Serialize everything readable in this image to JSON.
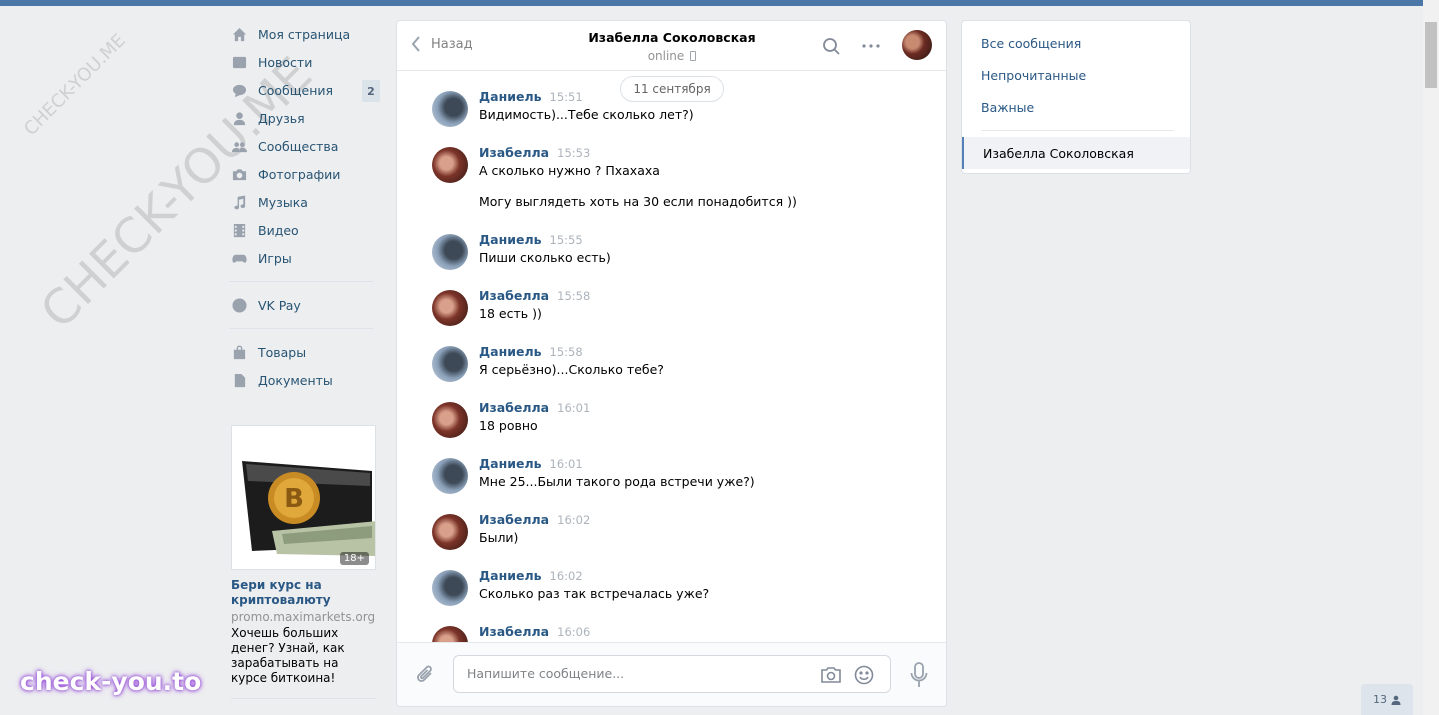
{
  "nav": {
    "items": [
      {
        "label": "Моя страница",
        "icon": "home-icon"
      },
      {
        "label": "Новости",
        "icon": "news-icon"
      },
      {
        "label": "Сообщения",
        "icon": "messages-icon",
        "badge": "2"
      },
      {
        "label": "Друзья",
        "icon": "friends-icon"
      },
      {
        "label": "Сообщества",
        "icon": "groups-icon"
      },
      {
        "label": "Фотографии",
        "icon": "camera-icon"
      },
      {
        "label": "Музыка",
        "icon": "music-icon"
      },
      {
        "label": "Видео",
        "icon": "video-icon"
      },
      {
        "label": "Игры",
        "icon": "games-icon"
      },
      {
        "label": "VK Pay",
        "icon": "vkpay-icon"
      },
      {
        "label": "Товары",
        "icon": "bag-icon"
      },
      {
        "label": "Документы",
        "icon": "document-icon"
      }
    ]
  },
  "ad": {
    "badge": "18+",
    "title": "Бери курс на криптовалюту",
    "domain": "promo.maximarkets.org",
    "text": "Хочешь больших денег? Узнай, как зарабатывать на курсе биткоина!"
  },
  "chat": {
    "back_label": "Назад",
    "peer_name": "Изабелла Соколовская",
    "peer_status": "online",
    "date_label": "11 сентября",
    "messages": [
      {
        "author": "Даниель",
        "time": "15:51",
        "lines": [
          "Видимость)...Тебе сколько лет?)"
        ]
      },
      {
        "author": "Изабелла",
        "time": "15:53",
        "lines": [
          "А сколько нужно ? Пхахаха",
          "Могу выглядеть хоть на 30 если понадобится ))"
        ]
      },
      {
        "author": "Даниель",
        "time": "15:55",
        "lines": [
          "Пиши сколько есть)"
        ]
      },
      {
        "author": "Изабелла",
        "time": "15:58",
        "lines": [
          "18 есть ))"
        ]
      },
      {
        "author": "Даниель",
        "time": "15:58",
        "lines": [
          "Я серьёзно)...Сколько тебе?"
        ]
      },
      {
        "author": "Изабелла",
        "time": "16:01",
        "lines": [
          "18 ровно"
        ]
      },
      {
        "author": "Даниель",
        "time": "16:01",
        "lines": [
          "Мне 25...Были такого рода встречи уже?)"
        ]
      },
      {
        "author": "Изабелла",
        "time": "16:02",
        "lines": [
          "Были)"
        ]
      },
      {
        "author": "Даниель",
        "time": "16:02",
        "lines": [
          "Сколько раз так встречалась уже?"
        ]
      },
      {
        "author": "Изабелла",
        "time": "16:06",
        "lines": []
      }
    ],
    "composer_placeholder": "Напишите сообщение..."
  },
  "filter": {
    "items": [
      "Все сообщения",
      "Непрочитанные",
      "Важные"
    ],
    "active": "Изабелла Соколовская"
  },
  "online_count": "13",
  "watermarks": {
    "diag_large": "CHECK-YOU.ME",
    "diag_small": "CHECK-YOU.ME",
    "badge": "check-you.to"
  },
  "colors": {
    "accent": "#4a76a8",
    "link": "#2a5885",
    "background": "#edeef0"
  }
}
